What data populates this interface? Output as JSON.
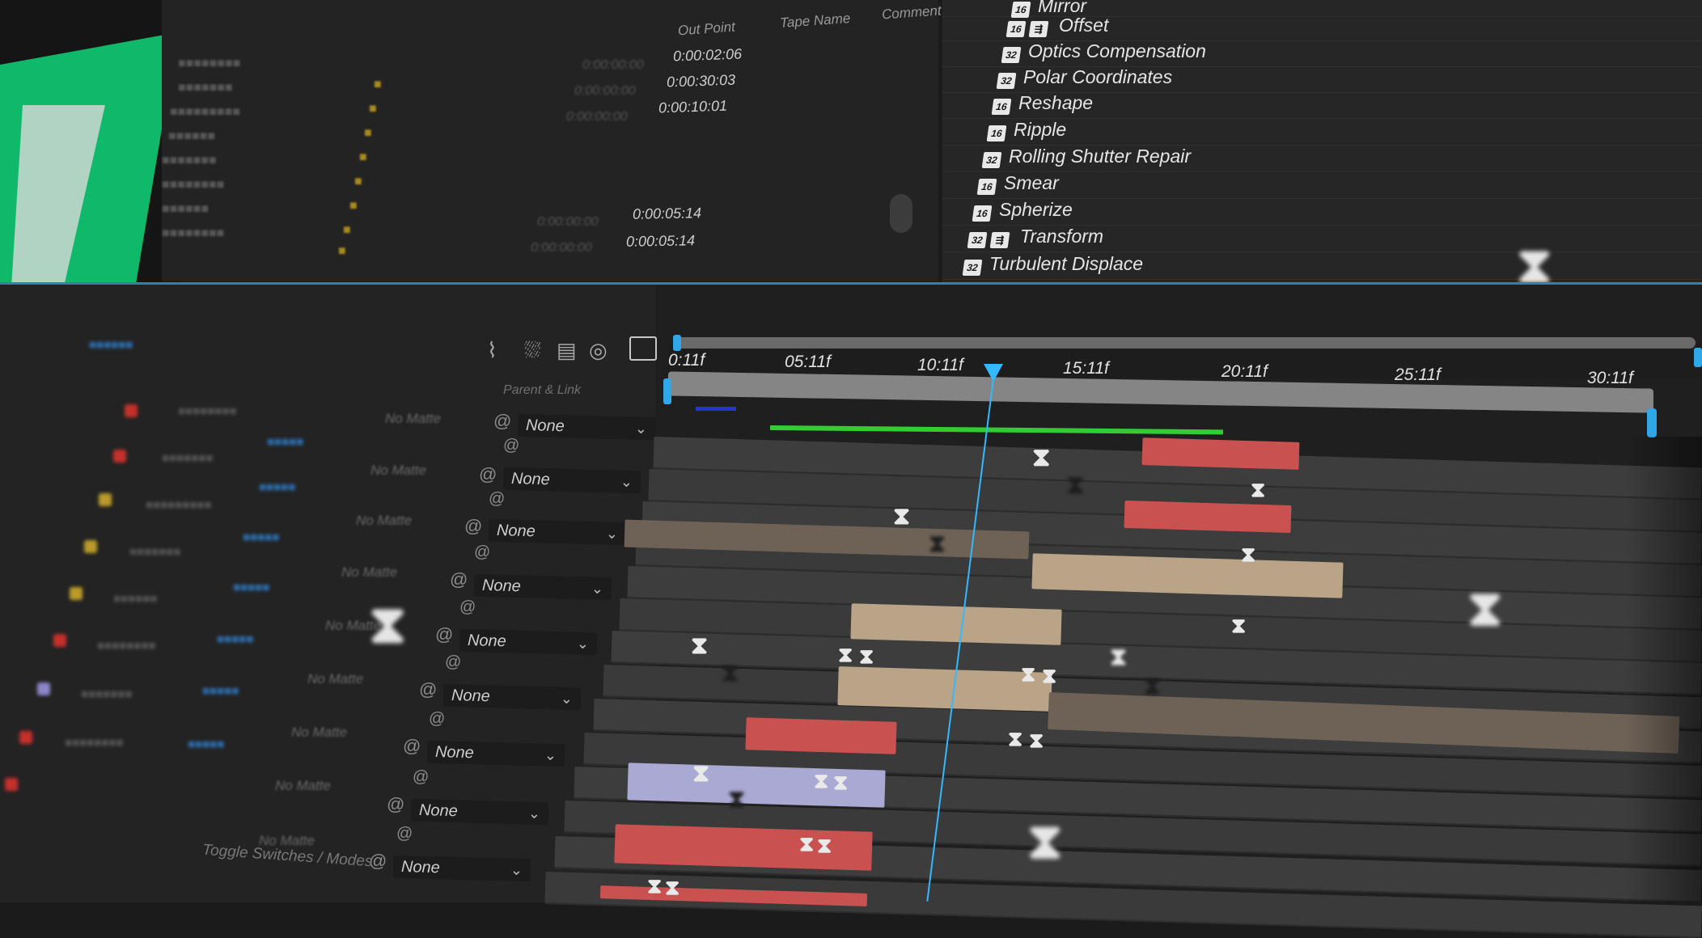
{
  "project_panel": {
    "headers": {
      "out_point": "Out Point",
      "tape_name": "Tape Name",
      "comment": "Comment"
    },
    "rows": [
      {
        "in_point": "0:00:00:00",
        "out_point": "0:00:02:06"
      },
      {
        "in_point": "0:00:00:00",
        "out_point": "0:00:30:03"
      },
      {
        "in_point": "0:00:00:00",
        "out_point": "0:00:10:01"
      },
      {
        "in_point": "0:00:00:00",
        "out_point": "0:00:05:14"
      },
      {
        "in_point": "0:00:00:00",
        "out_point": "0:00:05:14"
      }
    ]
  },
  "effects_panel": {
    "items": [
      {
        "name": "Mirror",
        "bits": "16"
      },
      {
        "name": "Offset",
        "bits": "16",
        "accelerated": true
      },
      {
        "name": "Optics Compensation",
        "bits": "32"
      },
      {
        "name": "Polar Coordinates",
        "bits": "32"
      },
      {
        "name": "Reshape",
        "bits": "16"
      },
      {
        "name": "Ripple",
        "bits": "16"
      },
      {
        "name": "Rolling Shutter Repair",
        "bits": "32"
      },
      {
        "name": "Smear",
        "bits": "16"
      },
      {
        "name": "Spherize",
        "bits": "16"
      },
      {
        "name": "Transform",
        "bits": "32",
        "accelerated": true
      },
      {
        "name": "Turbulent Displace",
        "bits": "32"
      }
    ]
  },
  "timeline": {
    "parent_link_header": "Parent & Link",
    "switches_toggle": "Toggle Switches / Modes",
    "ruler_labels": [
      "0:11f",
      "05:11f",
      "10:11f",
      "15:11f",
      "20:11f",
      "25:11f",
      "30:11f"
    ],
    "parent_values": [
      "None",
      "None",
      "None",
      "None",
      "None",
      "None",
      "None",
      "None",
      "None"
    ],
    "matte_values": [
      "No Matte",
      "No Matte",
      "No Matte",
      "No Matte",
      "No Matte",
      "No Matte",
      "No Matte",
      "No Matte"
    ],
    "playhead_time": "13:11f"
  },
  "colors": {
    "accent": "#34b8ff",
    "preview_green": "#10b86a",
    "bar_red": "#c95150",
    "bar_tan": "#b9a487",
    "bar_lavender": "#a9a9d4",
    "cache_green": "#33cc33"
  },
  "icons": {
    "project_hierarchy": "hierarchy-icon",
    "keyframe": "hourglass-keyframe-icon",
    "pickwhip": "spiral-pickwhip-icon",
    "graph_editor": "graph-editor-icon"
  }
}
